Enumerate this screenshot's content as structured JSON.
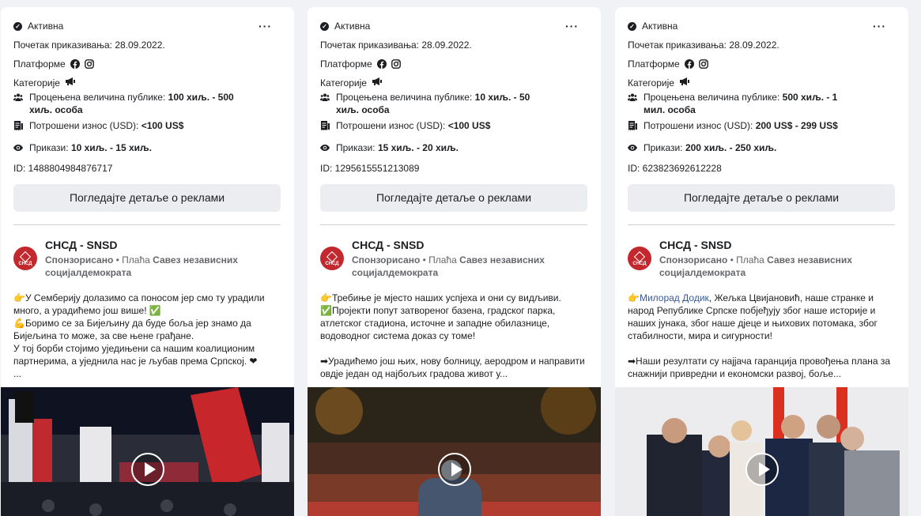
{
  "cards": [
    {
      "status": "Активна",
      "start": "Почетак приказивања: 28.09.2022.",
      "platforms_label": "Платформе",
      "categories_label": "Категорије",
      "audience_label": "Процењена величина публике: ",
      "audience_value": "100 хиљ. - 500 хиљ. особа",
      "spent_label": "Потрошени износ (USD): ",
      "spent_value": "<100 US$",
      "impressions_label": "Прикази: ",
      "impressions_value": "10 хиљ. - 15 хиљ.",
      "id": "ID: 1488804984876717",
      "button": "Погледајте детаље о реклами",
      "page_name": "СНСД - SNSD",
      "sponsored": "Спонзорисано",
      "paid_by_label": "Плаћа",
      "paid_by": "Савез независних социјалдемократа",
      "text_lines": [
        "👉У Семберију долазимо са поносом јер смо ту урадили много, а урадићемо још више! ✅",
        "💪Боримо се за Бијељину да буде боља јер знамо да Бијељина то може, за све њене грађане.",
        "У тој борби стојимо уједињени са нашим коалиционим партнерима, а уједнила нас је љубав према Српској. ❤",
        "..."
      ]
    },
    {
      "status": "Активна",
      "start": "Почетак приказивања: 28.09.2022.",
      "platforms_label": "Платформе",
      "categories_label": "Категорије",
      "audience_label": "Процењена величина публике: ",
      "audience_value": "10 хиљ. - 50 хиљ. особа",
      "spent_label": "Потрошени износ (USD): ",
      "spent_value": "<100 US$",
      "impressions_label": "Прикази: ",
      "impressions_value": "15 хиљ. - 20 хиљ.",
      "id": "ID: 1295615551213089",
      "button": "Погледајте детаље о реклами",
      "page_name": "СНСД - SNSD",
      "sponsored": "Спонзорисано",
      "paid_by_label": "Плаћа",
      "paid_by": "Савез независних социјалдемократа",
      "text_lines": [
        "👉Требиње је мјесто наших успјеха и они су видљиви. ✅Пројекти попут затвореног базена, градског парка, атлетског стадиона, источне и западне обилазнице, водоводног система доказ су томе!",
        "",
        "➡Урадићемо још њих, нову болницу, аеродром и направити овдје један од најбољих градова живот у..."
      ]
    },
    {
      "status": "Активна",
      "start": "Почетак приказивања: 28.09.2022.",
      "platforms_label": "Платформе",
      "categories_label": "Категорије",
      "audience_label": "Процењена величина публике: ",
      "audience_value": "500 хиљ. - 1 мил. особа",
      "spent_label": "Потрошени износ (USD): ",
      "spent_value": "200 US$ - 299 US$",
      "impressions_label": "Прикази: ",
      "impressions_value": "200 хиљ. - 250 хиљ.",
      "id": "ID: 623823692612228",
      "button": "Погледајте детаље о реклами",
      "page_name": "СНСД - SNSD",
      "sponsored": "Спонзорисано",
      "paid_by_label": "Плаћа",
      "paid_by": "Савез независних социјалдемократа",
      "text_link": "Милорад Додик",
      "text_lines": [
        "👉, Жељка Цвијановић, наше странке и народ Републике Српске побјеђују због наше историје и наших јунака, због наше дјеце и њихових потомака, због стабилности, мира и сигурности!",
        "",
        "➡Наши резултати су најјача гаранција провођења плана за снажнији привредни и економски развој, боље..."
      ]
    }
  ],
  "colors": {
    "card": "#ffffff",
    "bg": "#f0f2f5",
    "button": "#ebedf0",
    "logo": "#c3282e"
  },
  "icons": [
    "check-circle-icon",
    "more-dots-icon",
    "facebook-icon",
    "instagram-icon",
    "megaphone-icon",
    "people-icon",
    "receipt-icon",
    "eye-icon",
    "play-icon"
  ]
}
